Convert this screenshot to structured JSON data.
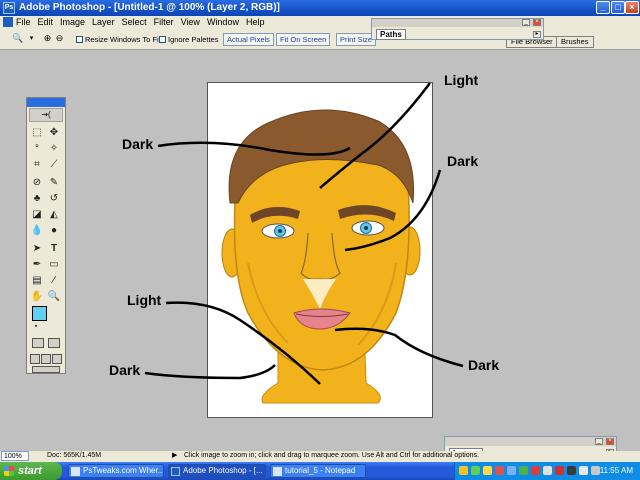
{
  "window": {
    "title": "Adobe Photoshop - [Untitled-1 @ 100% (Layer 2, RGB)]",
    "app_icon": "ps-icon",
    "controls": [
      "minimize-icon",
      "maximize-icon",
      "close-icon"
    ]
  },
  "menu": {
    "items": [
      "File",
      "Edit",
      "Image",
      "Layer",
      "Select",
      "Filter",
      "View",
      "Window",
      "Help"
    ]
  },
  "options_bar": {
    "tool_icon": "zoom-icon",
    "resize_windows_label": "Resize Windows To Fit",
    "ignore_palettes_label": "Ignore Palettes",
    "actual_pixels_label": "Actual Pixels",
    "fit_on_screen_label": "Fit On Screen",
    "print_size_label": "Print Size"
  },
  "palettes": {
    "paths_tab": "Paths",
    "file_browser_tab": "File Browser",
    "brushes_tab": "Brushes",
    "layers_tab": "Layers"
  },
  "annotations": {
    "light_top": "Light",
    "dark_left": "Dark",
    "dark_right": "Dark",
    "light_left": "Light",
    "dark_bottom_left": "Dark",
    "dark_bottom_right": "Dark"
  },
  "colors": {
    "foreground": "#63d0f2",
    "background": "#ffffff",
    "skin": "#f2b21c",
    "hair": "#8a5a2e"
  },
  "status": {
    "zoom": "100%",
    "doc": "Doc: 565K/1.45M",
    "hint": "Click image to zoom in; click and drag to marquee zoom.  Use Alt and Ctrl for additional options."
  },
  "taskbar": {
    "start_label": "start",
    "tasks": [
      "PsTweaks.com Wher...",
      "Adobe Photoshop - [...",
      "tutorial_5 - Notepad"
    ],
    "clock": "11:55 AM"
  }
}
